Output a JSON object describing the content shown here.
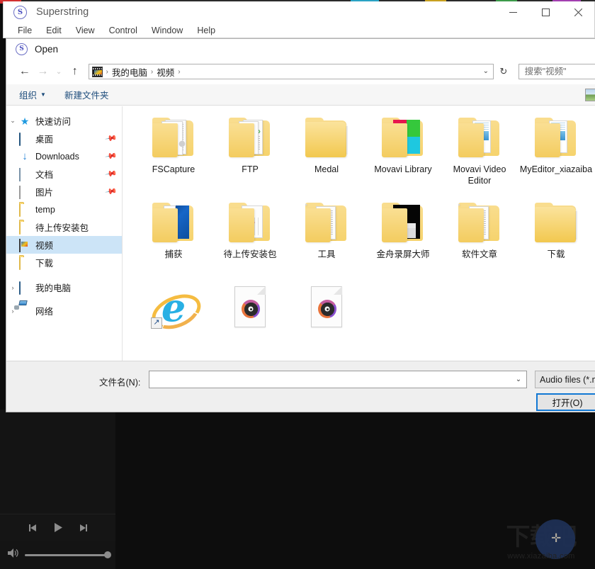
{
  "app_window": {
    "icon": "superstring-app-icon",
    "title": "Superstring",
    "menus": [
      "File",
      "Edit",
      "View",
      "Control",
      "Window",
      "Help"
    ],
    "controls": {
      "minimize": "minimize-icon",
      "maximize": "maximize-icon",
      "close": "close-icon"
    }
  },
  "dialog": {
    "title": "Open",
    "icon": "superstring-app-icon",
    "nav": {
      "back": "back-arrow",
      "forward": "forward-arrow",
      "recent": "recent-chevron",
      "up": "up-arrow",
      "refresh": "refresh-icon",
      "breadcrumb": [
        "我的电脑",
        "视频"
      ],
      "breadcrumb_trailing_sep": "›"
    },
    "search": {
      "placeholder": "搜索\"视频\""
    },
    "command_bar": {
      "organize": "组织",
      "new_folder": "新建文件夹",
      "view_icon": "view-mode-icon"
    },
    "sidebar": [
      {
        "label": "快速访问",
        "icon": "star-pin-icon",
        "depth": 0,
        "twisty": "⌄",
        "pinned": false,
        "selected": false
      },
      {
        "label": "桌面",
        "icon": "desktop-icon",
        "depth": 1,
        "twisty": "",
        "pinned": true,
        "selected": false
      },
      {
        "label": "Downloads",
        "icon": "download-icon",
        "depth": 1,
        "twisty": "",
        "pinned": true,
        "selected": false
      },
      {
        "label": "文档",
        "icon": "documents-icon",
        "depth": 1,
        "twisty": "",
        "pinned": true,
        "selected": false
      },
      {
        "label": "图片",
        "icon": "pictures-icon",
        "depth": 1,
        "twisty": "",
        "pinned": true,
        "selected": false
      },
      {
        "label": "temp",
        "icon": "folder-icon",
        "depth": 1,
        "twisty": "",
        "pinned": false,
        "selected": false
      },
      {
        "label": "待上传安装包",
        "icon": "folder-icon",
        "depth": 1,
        "twisty": "",
        "pinned": false,
        "selected": false
      },
      {
        "label": "视频",
        "icon": "video-folder-icon",
        "depth": 1,
        "twisty": "",
        "pinned": false,
        "selected": true
      },
      {
        "label": "下载",
        "icon": "folder-icon",
        "depth": 1,
        "twisty": "",
        "pinned": false,
        "selected": false
      },
      {
        "label": "我的电脑",
        "icon": "this-pc-icon",
        "depth": 0,
        "twisty": "›",
        "pinned": false,
        "selected": false
      },
      {
        "label": "网络",
        "icon": "network-icon",
        "depth": 0,
        "twisty": "›",
        "pinned": false,
        "selected": false
      }
    ],
    "files": [
      {
        "label": "FSCapture",
        "type": "folder",
        "preview": "gears"
      },
      {
        "label": "FTP",
        "type": "folder",
        "preview": "ftp"
      },
      {
        "label": "Medal",
        "type": "folder",
        "preview": "plain"
      },
      {
        "label": "Movavi Library",
        "type": "folder",
        "preview": "movavi"
      },
      {
        "label": "Movavi Video Editor",
        "type": "folder",
        "preview": "bluedoc"
      },
      {
        "label": "MyEditor_xiazaiba",
        "type": "folder",
        "preview": "bluedoc"
      },
      {
        "label": "捕获",
        "type": "folder",
        "preview": "windows"
      },
      {
        "label": "待上传安装包",
        "type": "folder",
        "preview": "chart"
      },
      {
        "label": "工具",
        "type": "folder",
        "preview": "sheets"
      },
      {
        "label": "金舟录屏大师",
        "type": "folder",
        "preview": "black"
      },
      {
        "label": "软件文章",
        "type": "folder",
        "preview": "sheets"
      },
      {
        "label": "下载",
        "type": "folder",
        "preview": "plain"
      },
      {
        "label": "",
        "type": "shortcut",
        "preview": "ie"
      },
      {
        "label": "",
        "type": "audio",
        "preview": "audio"
      },
      {
        "label": "",
        "type": "audio",
        "preview": "audio"
      }
    ],
    "footer": {
      "filename_label": "文件名(N):",
      "filename_value": "",
      "filename_caret": "⌄",
      "filter_value": "Audio files (*.m",
      "open_button": "打开(O)"
    }
  },
  "player": {
    "prev_button": "previous-track-icon",
    "play_button": "play-icon",
    "next_button": "next-track-icon",
    "volume_icon": "volume-icon",
    "volume_level": 100
  },
  "watermark": {
    "text": "下载吧",
    "url": "www.xiazaiba.com"
  },
  "colors": {
    "accent": "#1178d4",
    "selection": "#cce4f7",
    "folder": "#f3cc5f",
    "link": "#1a4a7a"
  }
}
